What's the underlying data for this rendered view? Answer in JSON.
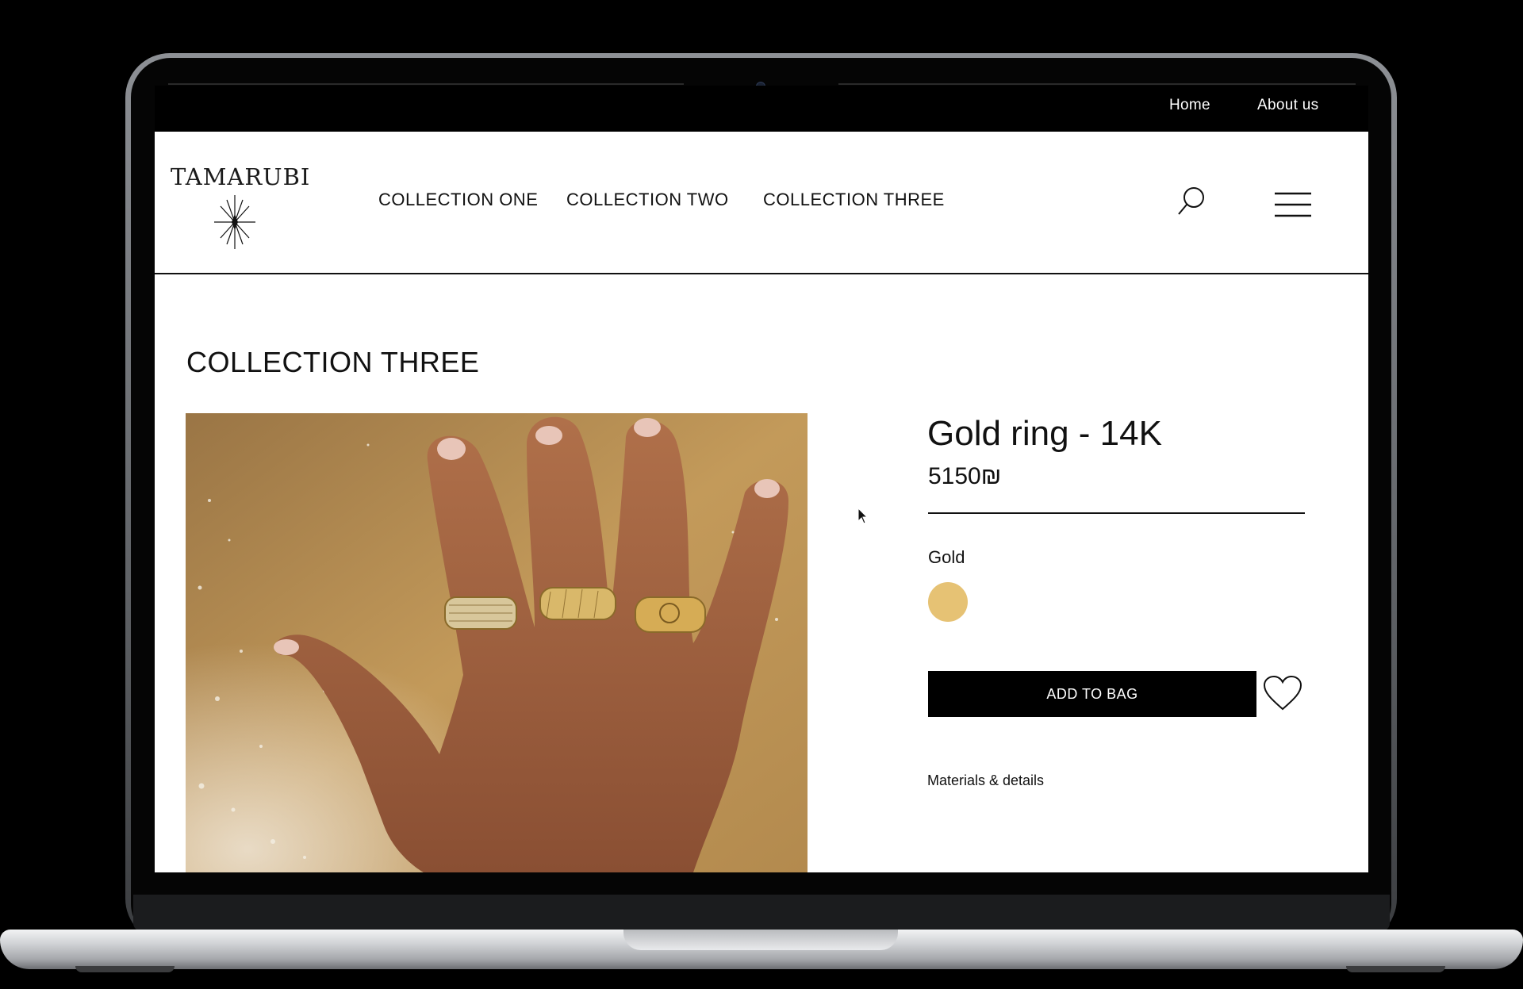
{
  "topbar": {
    "links": [
      "Home",
      "About us"
    ]
  },
  "header": {
    "logo_text": "TAMARUBI",
    "nav": [
      "COLLECTION ONE",
      "COLLECTION TWO",
      "COLLECTION THREE"
    ],
    "icons": [
      "search-icon",
      "hamburger-menu-icon"
    ]
  },
  "main": {
    "section_title": "COLLECTION THREE",
    "product": {
      "title": "Gold ring - 14K",
      "price": "5150₪",
      "color_label": "Gold",
      "swatch_color": "#e6c274",
      "add_to_bag_label": "ADD TO BAG",
      "wishlist_icon": "heart-icon",
      "details_link": "Materials & details"
    }
  },
  "colors": {
    "topbar_bg": "#000000",
    "page_bg": "#ffffff",
    "button_bg": "#000000",
    "gold": "#e6c274",
    "sand": "#bb9150",
    "skin": "#9a5a3a"
  }
}
